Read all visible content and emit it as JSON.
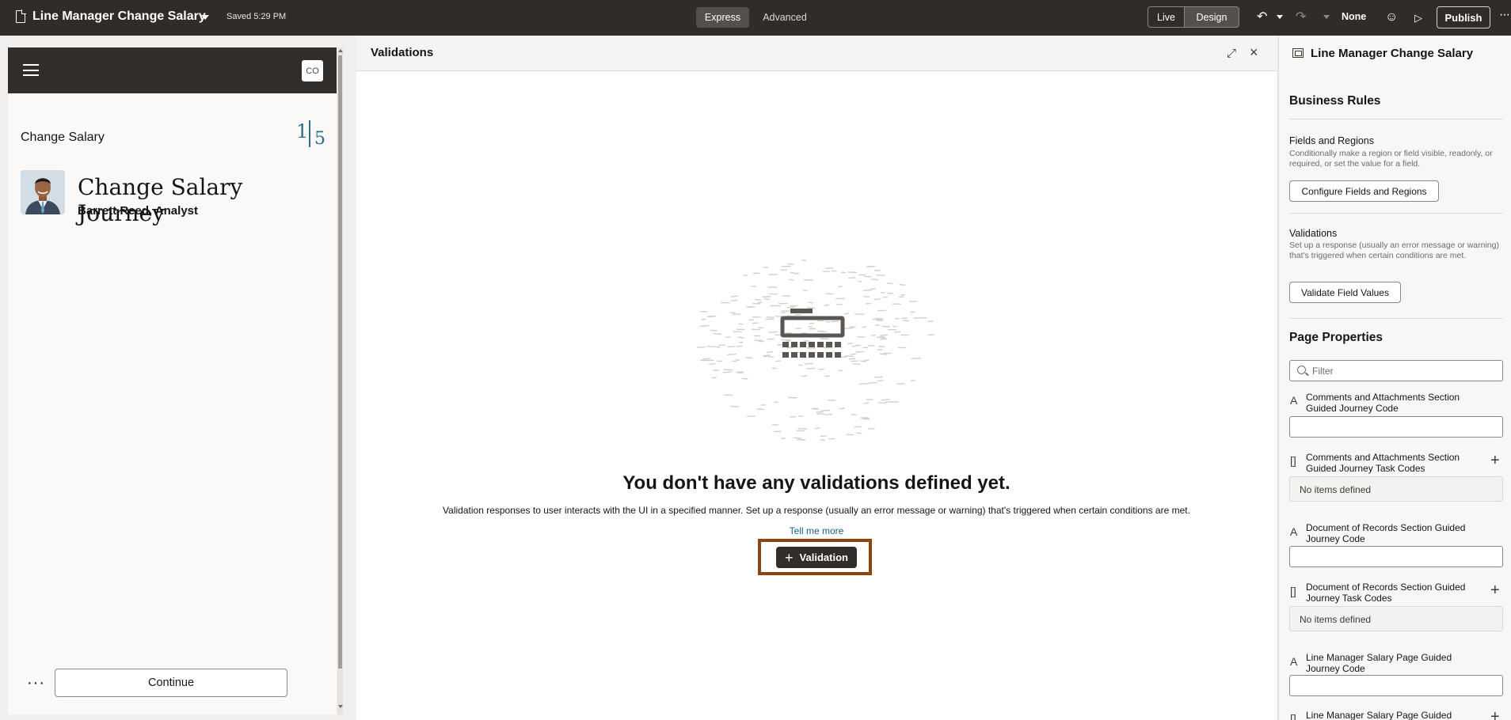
{
  "topbar": {
    "app_title": "Line Manager Change Salary",
    "saved_status": "Saved 5:29 PM",
    "mode_tabs": [
      "Express",
      "Advanced"
    ],
    "view_toggle": [
      "Live",
      "Design"
    ],
    "sandbox_label": "None",
    "publish_label": "Publish",
    "icons": [
      "document-icon",
      "caret-down-icon",
      "undo-icon",
      "redo-icon",
      "smiley-icon",
      "play-icon",
      "more-icon"
    ]
  },
  "preview": {
    "user_initials": "CO",
    "section_label": "Change Salary",
    "step_current": "1",
    "step_total": "5",
    "journey_title": "Change Salary Journey",
    "journey_subtitle": "Barrett Reed, Analyst",
    "more_label": "...",
    "continue_label": "Continue"
  },
  "validations_panel": {
    "title": "Validations",
    "empty_heading": "You don't have any validations defined yet.",
    "empty_description": "Validation responses to user interacts with the UI in a specified manner. Set up a response (usually an error message or warning) that's triggered when certain conditions are met.",
    "tell_me_more": "Tell me more",
    "add_validation_label": "Validation"
  },
  "right_panel": {
    "title": "Line Manager Change Salary",
    "business_rules": {
      "heading": "Business Rules",
      "fields_regions": {
        "label": "Fields and Regions",
        "help": "Conditionally make a region or field visible, readonly, or required, or set the value for a field.",
        "button": "Configure Fields and Regions"
      },
      "validations": {
        "label": "Validations",
        "help": "Set up a response (usually an error message or warning) that's triggered when certain conditions are met.",
        "button": "Validate Field Values"
      }
    },
    "page_properties": {
      "heading": "Page Properties",
      "filter_placeholder": "Filter",
      "properties": [
        {
          "label": "Comments and Attachments Section Guided Journey Code",
          "type": "text"
        },
        {
          "label": "Comments and Attachments Section Guided Journey Task Codes",
          "type": "list",
          "empty_text": "No items defined"
        },
        {
          "label": "Document of Records Section Guided Journey Code",
          "type": "text"
        },
        {
          "label": "Document of Records Section Guided Journey Task Codes",
          "type": "list",
          "empty_text": "No items defined"
        },
        {
          "label": "Line Manager Salary Page Guided Journey Code",
          "type": "text"
        },
        {
          "label": "Line Manager Salary Page Guided",
          "type": "list"
        }
      ]
    }
  },
  "colors": {
    "topbar_bg": "#2f2c2a",
    "phone_header_bg": "#312d2a",
    "accent_link": "#1b5f8a",
    "step_indicator": "#2a6d8f",
    "highlight_border": "#8b4513"
  }
}
